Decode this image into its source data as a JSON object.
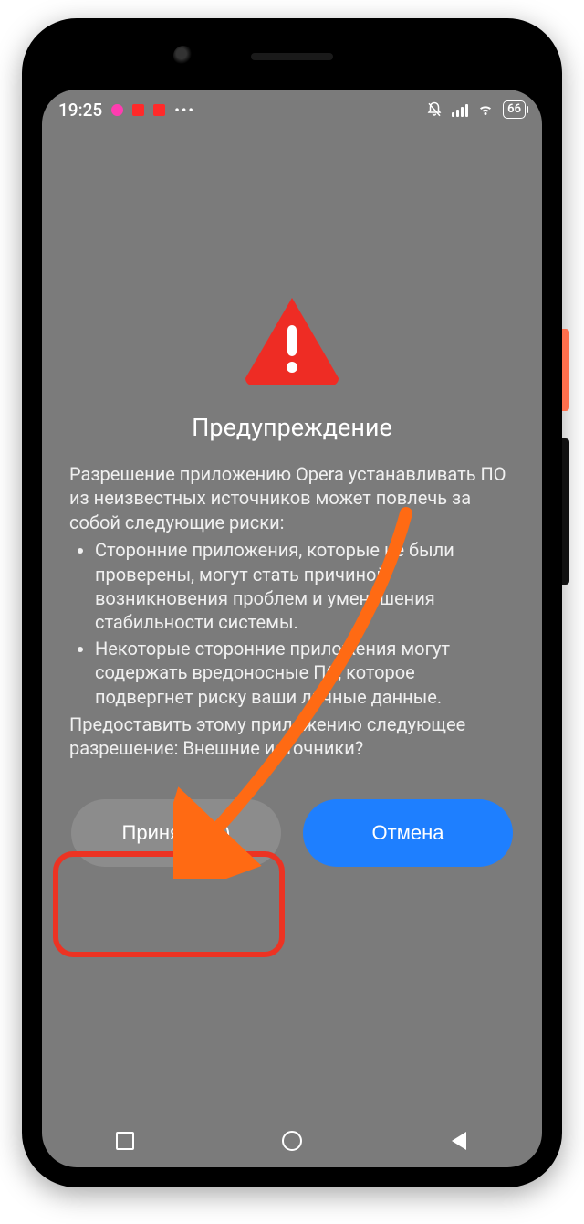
{
  "status": {
    "time": "19:25",
    "notif_colors": [
      "#ff3cb0",
      "#ff2a2a",
      "#ff2a2a"
    ],
    "battery_text": "66"
  },
  "dialog": {
    "title": "Предупреждение",
    "intro": "Разрешение приложению Opera устанавливать ПО из неизвестных источников может повлечь за собой следующие риски:",
    "bullets": [
      "Сторонние приложения, которые не были проверены, могут стать причиной возникновения проблем и уменьшения стабильности системы.",
      "Некоторые сторонние приложения могут содержать вредоносные ПО, которое подвергнет риску ваши личные данные."
    ],
    "question": "Предоставить этому приложению следующее разрешение: Внешние источники?",
    "accept_label": "Принять (3)",
    "cancel_label": "Отмена"
  }
}
